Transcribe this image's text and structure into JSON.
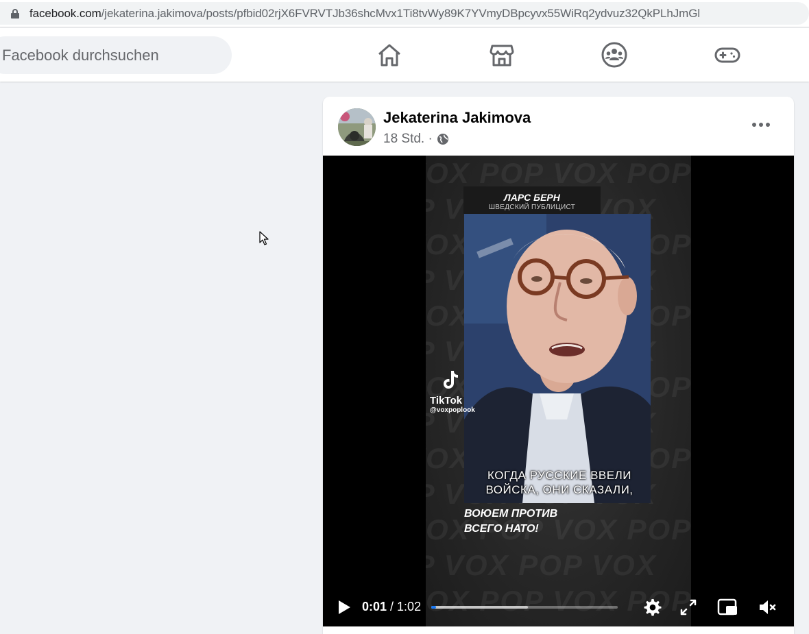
{
  "browser": {
    "url_host": "facebook.com",
    "url_path": "/jekaterina.jakimova/posts/pfbid02rjX6FVRVTJb36shcMvx1Ti8tvWy89K7YVmyDBpcyvx55WiRq2ydvuz32QkPLhJmGl"
  },
  "header": {
    "search_placeholder": "Facebook durchsuchen",
    "nav": [
      "home-icon",
      "marketplace-icon",
      "groups-icon",
      "gaming-icon"
    ]
  },
  "post": {
    "author": "Jekaterina Jakimova",
    "time": "18 Std.",
    "separator": "·",
    "audience_icon": "globe-icon",
    "video": {
      "name_title": "ЛАРС БЕРН",
      "name_subtitle": "ШВЕДСКИЙ ПУБЛИЦИСТ",
      "tiktok_word": "TikTok",
      "tiktok_handle": "@voxpoplook",
      "subtitle_line1": "КОГДА РУССКИЕ ВВЕЛИ",
      "subtitle_line2": "ВОЙСКА, ОНИ СКАЗАЛИ,",
      "quote_line1": "ВОЮЕМ ПРОТИВ",
      "quote_line2": "ВСЕГО НАТО!",
      "current_time": "0:01",
      "time_separator": " / ",
      "duration": "1:02",
      "progress_played": 0.025,
      "progress_buffered": 0.52,
      "muted": true
    }
  },
  "colors": {
    "accent": "#1877f2",
    "background": "#f0f2f5",
    "secondary_text": "#65676b"
  }
}
